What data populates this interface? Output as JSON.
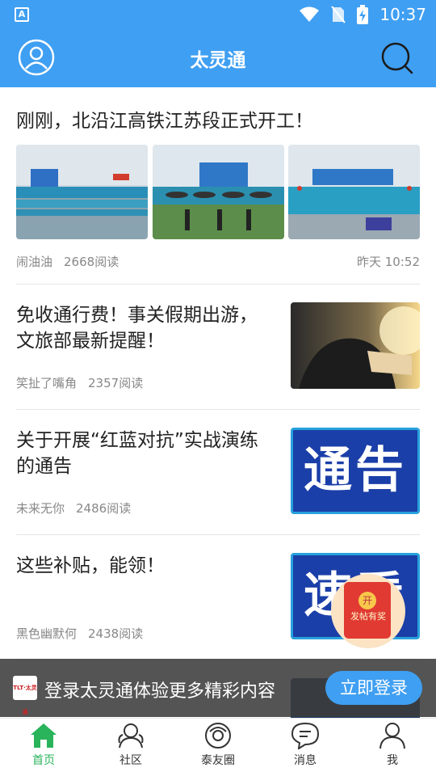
{
  "status_bar": {
    "time": "10:37",
    "app_badge": "A"
  },
  "header": {
    "title": "太灵通"
  },
  "feed": [
    {
      "title": "刚刚，北沿江高铁江苏段正式开工！",
      "author": "闹油油",
      "reads": "2668阅读",
      "time": "昨天 10:52",
      "thumb_count": 3
    },
    {
      "title": "免收通行费！事关假期出游，文旅部最新提醒！",
      "author": "笑扯了嘴角",
      "reads": "2357阅读"
    },
    {
      "title": "关于开展“红蓝对抗”实战演练的通告",
      "author": "未来无你",
      "reads": "2486阅读",
      "image_text": "通告"
    },
    {
      "title": "这些补贴，能领！",
      "author": "黑色幽默何",
      "reads": "2438阅读",
      "image_text": "速看"
    }
  ],
  "red_packet": {
    "coin": "开",
    "label": "发帖有奖"
  },
  "login_banner": {
    "logo_text": "TLT·太灵通",
    "text": "登录太灵通体验更多精彩内容",
    "button": "立即登录"
  },
  "bottom_nav": [
    {
      "label": "首页",
      "icon": "home-icon",
      "active": true
    },
    {
      "label": "社区",
      "icon": "community-icon",
      "active": false
    },
    {
      "label": "泰友圈",
      "icon": "circle-icon",
      "active": false
    },
    {
      "label": "消息",
      "icon": "message-icon",
      "active": false
    },
    {
      "label": "我",
      "icon": "profile-icon",
      "active": false
    }
  ],
  "colors": {
    "brand": "#3f9ff2",
    "active_tab": "#29b35a",
    "red_packet": "#e03a32"
  }
}
